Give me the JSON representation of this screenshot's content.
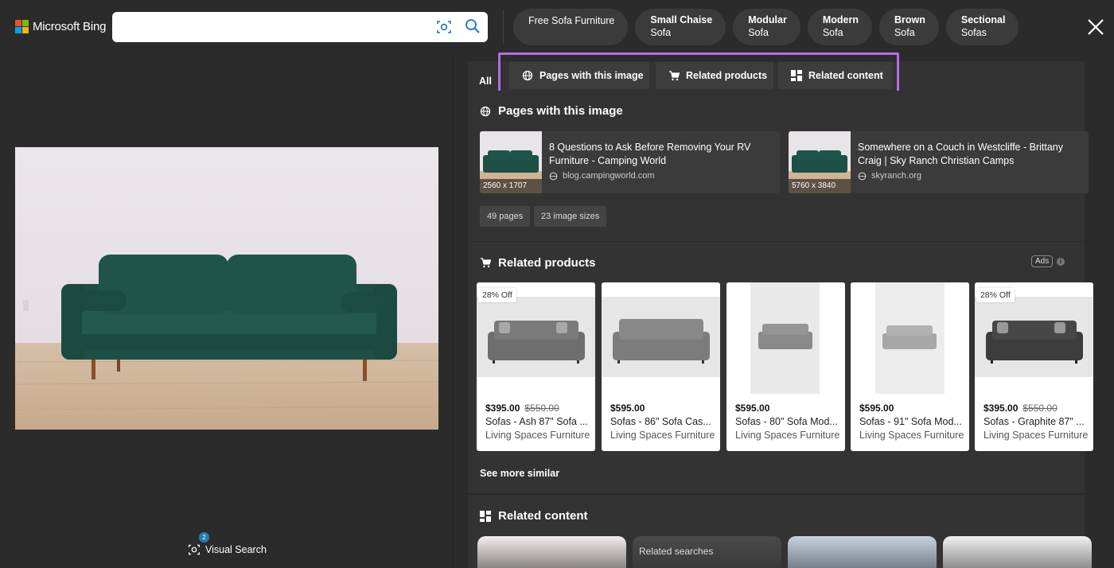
{
  "header": {
    "brand": "Microsoft Bing",
    "search": {
      "value": "",
      "placeholder": ""
    },
    "chips": [
      {
        "line1": "Free Sofa Furniture",
        "line2": ""
      },
      {
        "line1": "Small Chaise",
        "line2": "Sofa"
      },
      {
        "line1": "Modular",
        "line2": "Sofa"
      },
      {
        "line1": "Modern",
        "line2": "Sofa"
      },
      {
        "line1": "Brown",
        "line2": "Sofa"
      },
      {
        "line1": "Sectional",
        "line2": "Sofas"
      }
    ],
    "colors": {
      "ms_red": "#f25022",
      "ms_green": "#7fba00",
      "ms_blue": "#00a4ef",
      "ms_yellow": "#ffb900"
    }
  },
  "left": {
    "visual_search_label": "Visual Search",
    "visual_search_badge": "2"
  },
  "tabs": {
    "all": "All",
    "items": [
      {
        "label": "Pages with this image",
        "icon": "globe-icon"
      },
      {
        "label": "Related products",
        "icon": "cart-icon"
      },
      {
        "label": "Related content",
        "icon": "grid-icon"
      }
    ],
    "highlight_color": "#b06fe3"
  },
  "pages_section": {
    "title": "Pages with this image",
    "cards": [
      {
        "title": "8 Questions to Ask Before Removing Your RV Furniture - Camping World",
        "domain": "blog.campingworld.com",
        "dims": "2560 x 1707"
      },
      {
        "title": "Somewhere on a Couch in Westcliffe - Brittany Craig | Sky Ranch Christian Camps",
        "domain": "skyranch.org",
        "dims": "5760 x 3840"
      }
    ],
    "pills": [
      "49 pages",
      "23 image sizes"
    ]
  },
  "products_section": {
    "title": "Related products",
    "ads_label": "Ads",
    "info": "i",
    "products": [
      {
        "badge": "28% Off",
        "price": "$395.00",
        "old_price": "$550.00",
        "name": "Sofas - Ash 87\" Sofa ...",
        "seller": "Living Spaces Furniture"
      },
      {
        "badge": "",
        "price": "$595.00",
        "old_price": "",
        "name": "Sofas - 86\" Sofa Cas...",
        "seller": "Living Spaces Furniture"
      },
      {
        "badge": "",
        "price": "$595.00",
        "old_price": "",
        "name": "Sofas - 80\" Sofa Mod...",
        "seller": "Living Spaces Furniture"
      },
      {
        "badge": "",
        "price": "$595.00",
        "old_price": "",
        "name": "Sofas - 91\" Sofa Mod...",
        "seller": "Living Spaces Furniture"
      },
      {
        "badge": "28% Off",
        "price": "$395.00",
        "old_price": "$550.00",
        "name": "Sofas - Graphite 87\" ...",
        "seller": "Living Spaces Furniture"
      }
    ],
    "see_more": "See more similar"
  },
  "related_content": {
    "title": "Related content",
    "card_label": "Related searches"
  }
}
